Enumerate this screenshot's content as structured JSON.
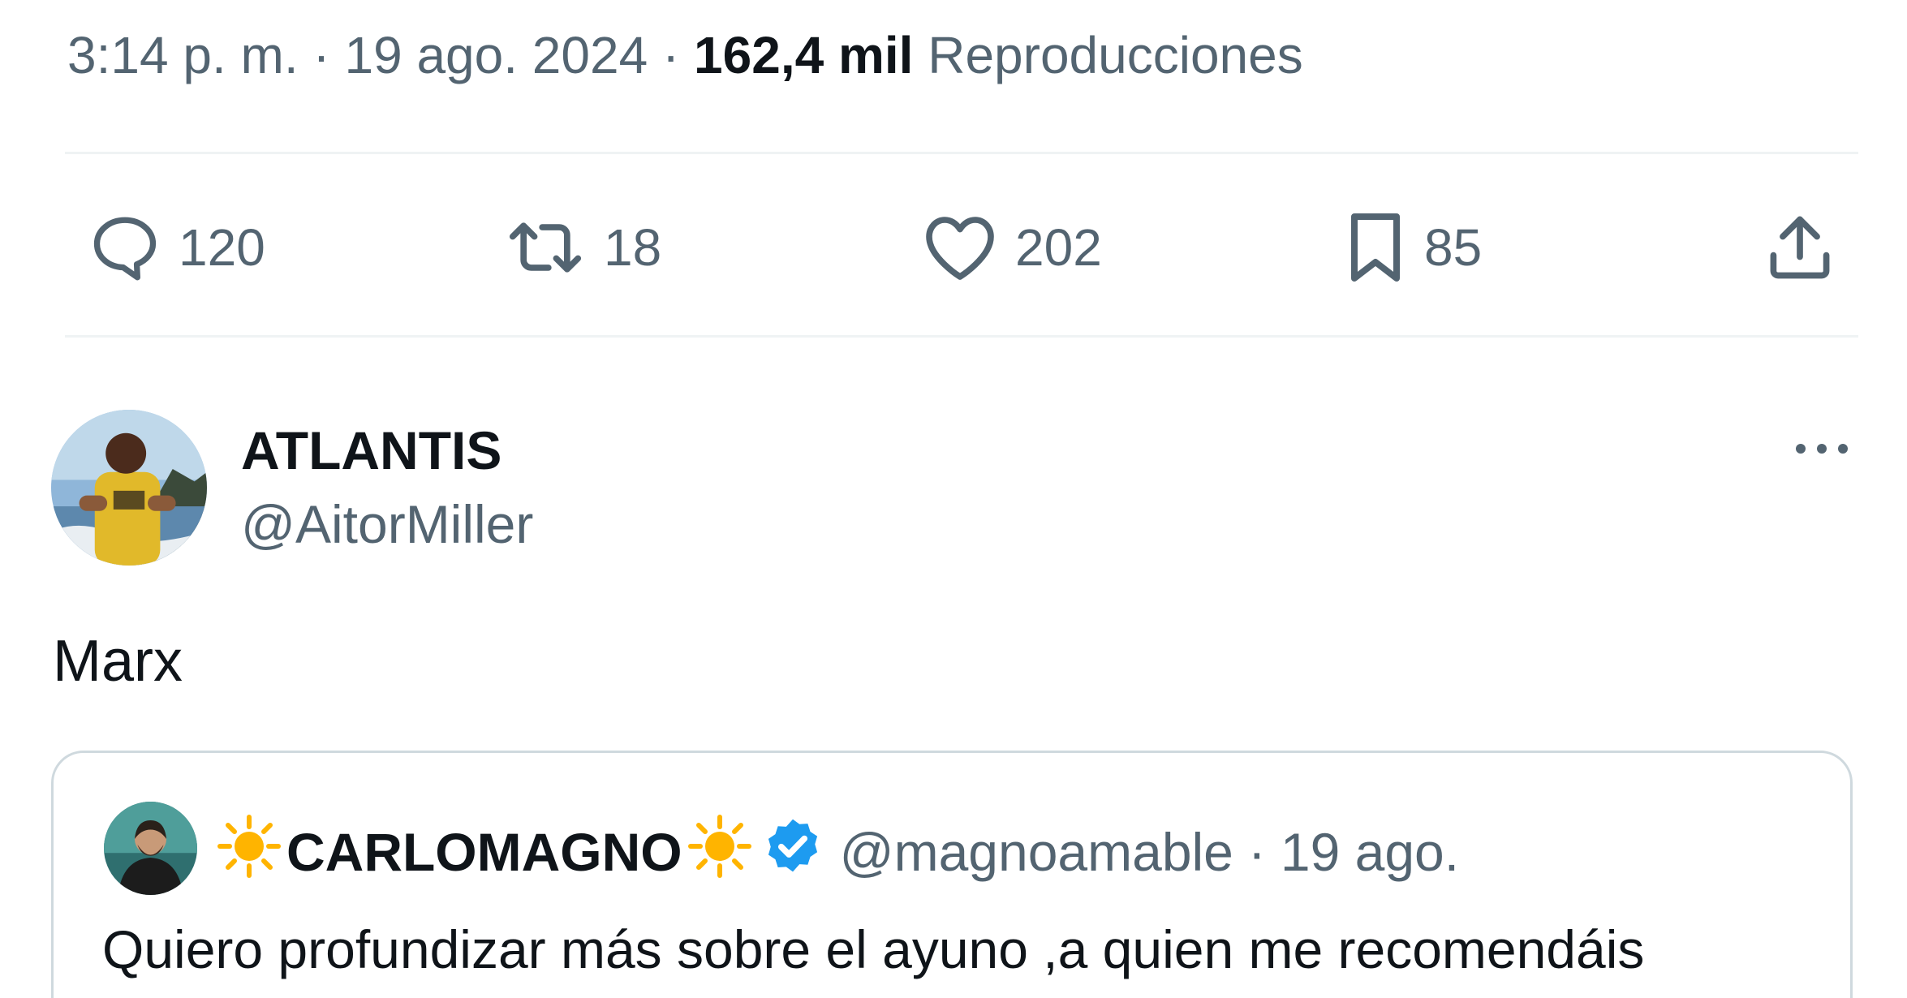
{
  "tweet": {
    "meta": {
      "time": "3:14 p. m.",
      "separator": "·",
      "date": "19 ago. 2024",
      "views_count": "162,4 mil",
      "views_label": "Reproducciones"
    },
    "actions": {
      "replies": "120",
      "retweets": "18",
      "likes": "202",
      "bookmarks": "85"
    },
    "author": {
      "name": "ATLANTIS",
      "handle": "@AitorMiller"
    },
    "text": "Marx",
    "quoted": {
      "name": "CARLOMAGNO",
      "handle": "@magnoamable",
      "separator": "·",
      "date": "19 ago.",
      "text": "Quiero profundizar más sobre el ayuno ,a quien me recomendáis"
    }
  },
  "icons": {
    "reply": "reply-icon",
    "retweet": "retweet-icon",
    "like": "heart-icon",
    "bookmark": "bookmark-icon",
    "share": "share-icon",
    "more": "more-icon",
    "verified": "verified-badge-icon",
    "sun": "sun-emoji-icon"
  },
  "colors": {
    "text_primary": "#0f1419",
    "text_secondary": "#536471",
    "divider": "#eff3f4",
    "verified_blue": "#1d9bf0",
    "sun_yellow": "#ffb400"
  }
}
